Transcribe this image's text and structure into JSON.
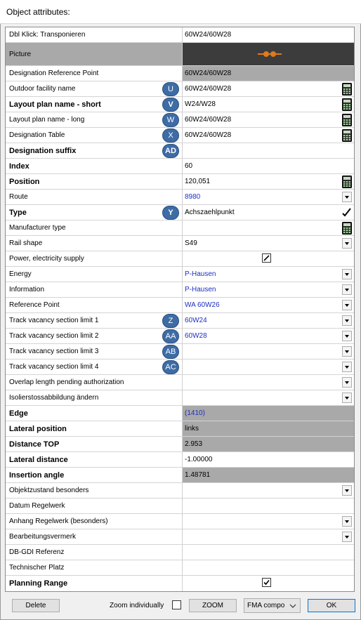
{
  "window": {
    "title": "Object attributes:"
  },
  "rows": [
    {
      "label": "Dbl Klick: Transponieren",
      "value": "60W24/60W28",
      "bold": false,
      "control": "none"
    },
    {
      "label": "Picture",
      "value": "",
      "bold": false,
      "control": "picture"
    },
    {
      "label": "Designation Reference Point",
      "value": "60W24/60W28",
      "bold": false,
      "control": "none"
    },
    {
      "label": "Outdoor facility name",
      "value": "60W24/60W28",
      "bold": false,
      "badge": "U",
      "control": "calculator"
    },
    {
      "label": "Layout plan name - short",
      "value": "W24/W28",
      "bold": true,
      "badge": "V",
      "control": "calculator"
    },
    {
      "label": "Layout plan name - long",
      "value": "60W24/60W28",
      "bold": false,
      "badge": "W",
      "control": "calculator"
    },
    {
      "label": "Designation Table",
      "value": "60W24/60W28",
      "bold": false,
      "badge": "X",
      "control": "calculator"
    },
    {
      "label": "Designation suffix",
      "value": "",
      "bold": true,
      "badge": "AD",
      "control": "none"
    },
    {
      "label": "Index",
      "value": "60",
      "bold": true,
      "control": "none"
    },
    {
      "label": "Position",
      "value": "120,051",
      "bold": true,
      "control": "calculator"
    },
    {
      "label": "Route",
      "value": "8980",
      "bold": false,
      "control": "dropdown"
    },
    {
      "label": "Type",
      "value": "Achszaehlpunkt",
      "bold": true,
      "badge": "Y",
      "control": "check"
    },
    {
      "label": "Manufacturer type",
      "value": "",
      "bold": false,
      "control": "calculator"
    },
    {
      "label": "Rail shape",
      "value": "S49",
      "bold": false,
      "control": "dropdown"
    },
    {
      "label": "Power, electricity supply",
      "value": "",
      "bold": false,
      "control": "checkbox-edit"
    },
    {
      "label": "Energy",
      "value": "P-Hausen",
      "bold": false,
      "control": "dropdown"
    },
    {
      "label": "Information",
      "value": "P-Hausen",
      "bold": false,
      "control": "dropdown"
    },
    {
      "label": "Reference Point",
      "value": "WA 60W26",
      "bold": false,
      "control": "dropdown"
    },
    {
      "label": "Track vacancy section limit 1",
      "value": "60W24",
      "bold": false,
      "badge": "Z",
      "control": "dropdown"
    },
    {
      "label": "Track vacancy section limit 2",
      "value": "60W28",
      "bold": false,
      "badge": "AA",
      "control": "dropdown"
    },
    {
      "label": "Track vacancy section limit 3",
      "value": "",
      "bold": false,
      "badge": "AB",
      "control": "dropdown"
    },
    {
      "label": "Track vacancy section limit 4",
      "value": "",
      "bold": false,
      "badge": "AC",
      "control": "dropdown"
    },
    {
      "label": "Overlap length pending authorization",
      "value": "",
      "bold": false,
      "control": "dropdown"
    },
    {
      "label": "Isolierstossabbildung ändern",
      "value": "",
      "bold": false,
      "control": "dropdown"
    },
    {
      "label": "Edge",
      "value": "(1410)",
      "bold": true,
      "control": "none"
    },
    {
      "label": "Lateral position",
      "value": "links",
      "bold": true,
      "control": "none"
    },
    {
      "label": "Distance TOP",
      "value": "2.953",
      "bold": true,
      "control": "none"
    },
    {
      "label": "Lateral distance",
      "value": "-1.00000",
      "bold": true,
      "control": "none"
    },
    {
      "label": "Insertion angle",
      "value": "1.48781",
      "bold": true,
      "control": "none"
    },
    {
      "label": "Objektzustand besonders",
      "value": "",
      "bold": false,
      "control": "dropdown"
    },
    {
      "label": "Datum Regelwerk",
      "value": "",
      "bold": false,
      "control": "none"
    },
    {
      "label": "Anhang Regelwerk (besonders)",
      "value": "",
      "bold": false,
      "control": "dropdown"
    },
    {
      "label": "Bearbeitungsvermerk",
      "value": "",
      "bold": false,
      "control": "dropdown"
    },
    {
      "label": "DB-GDI Referenz",
      "value": "",
      "bold": false,
      "control": "none"
    },
    {
      "label": "Technischer Platz",
      "value": "",
      "bold": false,
      "control": "none"
    },
    {
      "label": "Planning Range",
      "value": "",
      "bold": true,
      "control": "checkbox-checked"
    }
  ],
  "footer": {
    "delete_label": "Delete",
    "zoom_individually_label": "Zoom individually",
    "zoom_label": "ZOOM",
    "combo_value": "FMA compo",
    "ok_label": "OK"
  },
  "colors": {
    "grey_cell": "#a9a9a9",
    "dark_cell": "#3c3c3c",
    "link_blue": "#1c2fc4",
    "badge_blue": "#3e6ca5",
    "picture_symbol": "#e07a1f"
  }
}
